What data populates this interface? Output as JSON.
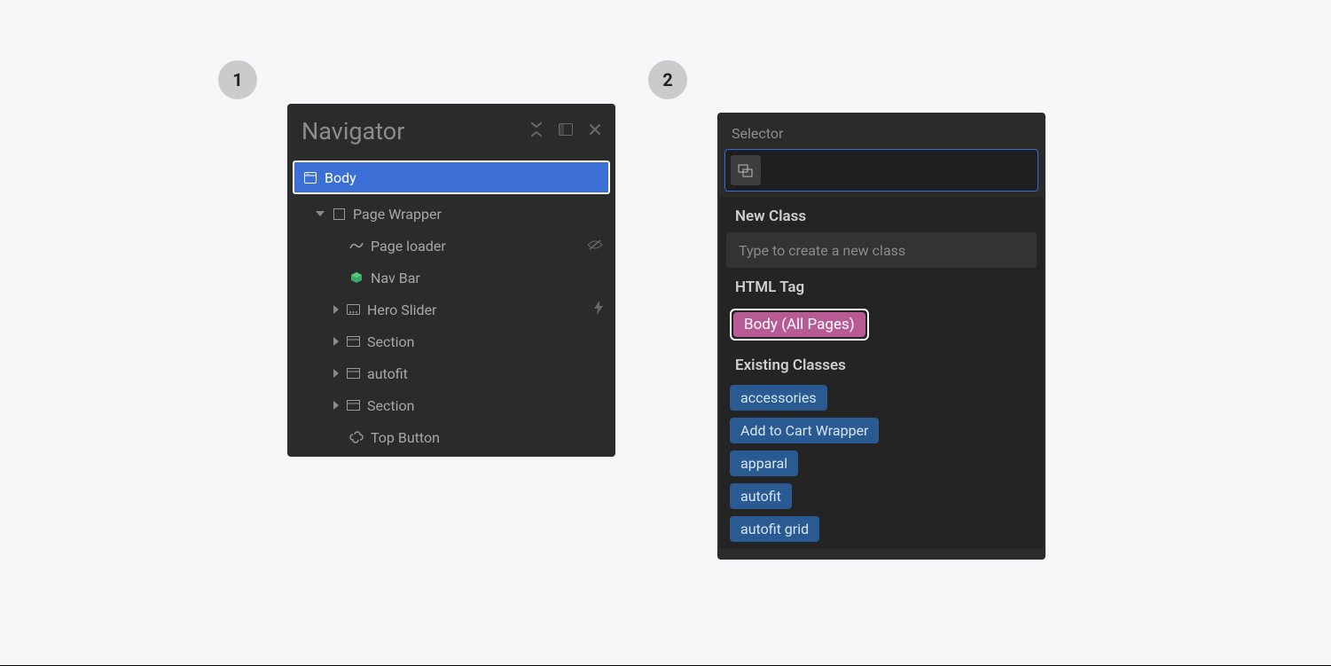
{
  "steps": {
    "one": "1",
    "two": "2"
  },
  "navigator": {
    "title": "Navigator",
    "tree": {
      "body": "Body",
      "pageWrapper": "Page Wrapper",
      "pageLoader": "Page loader",
      "navBar": "Nav Bar",
      "heroSlider": "Hero Slider",
      "section1": "Section",
      "autofit": "autofit",
      "section2": "Section",
      "topButton": "Top Button"
    }
  },
  "selector": {
    "label": "Selector",
    "newClassHeading": "New Class",
    "newClassPlaceholder": "Type to create a new class",
    "htmlTagHeading": "HTML Tag",
    "htmlTagValue": "Body (All Pages)",
    "existingHeading": "Existing Classes",
    "classes": {
      "c0": "accessories",
      "c1": "Add to Cart Wrapper",
      "c2": "apparal",
      "c3": "autofit",
      "c4": "autofit grid"
    }
  }
}
